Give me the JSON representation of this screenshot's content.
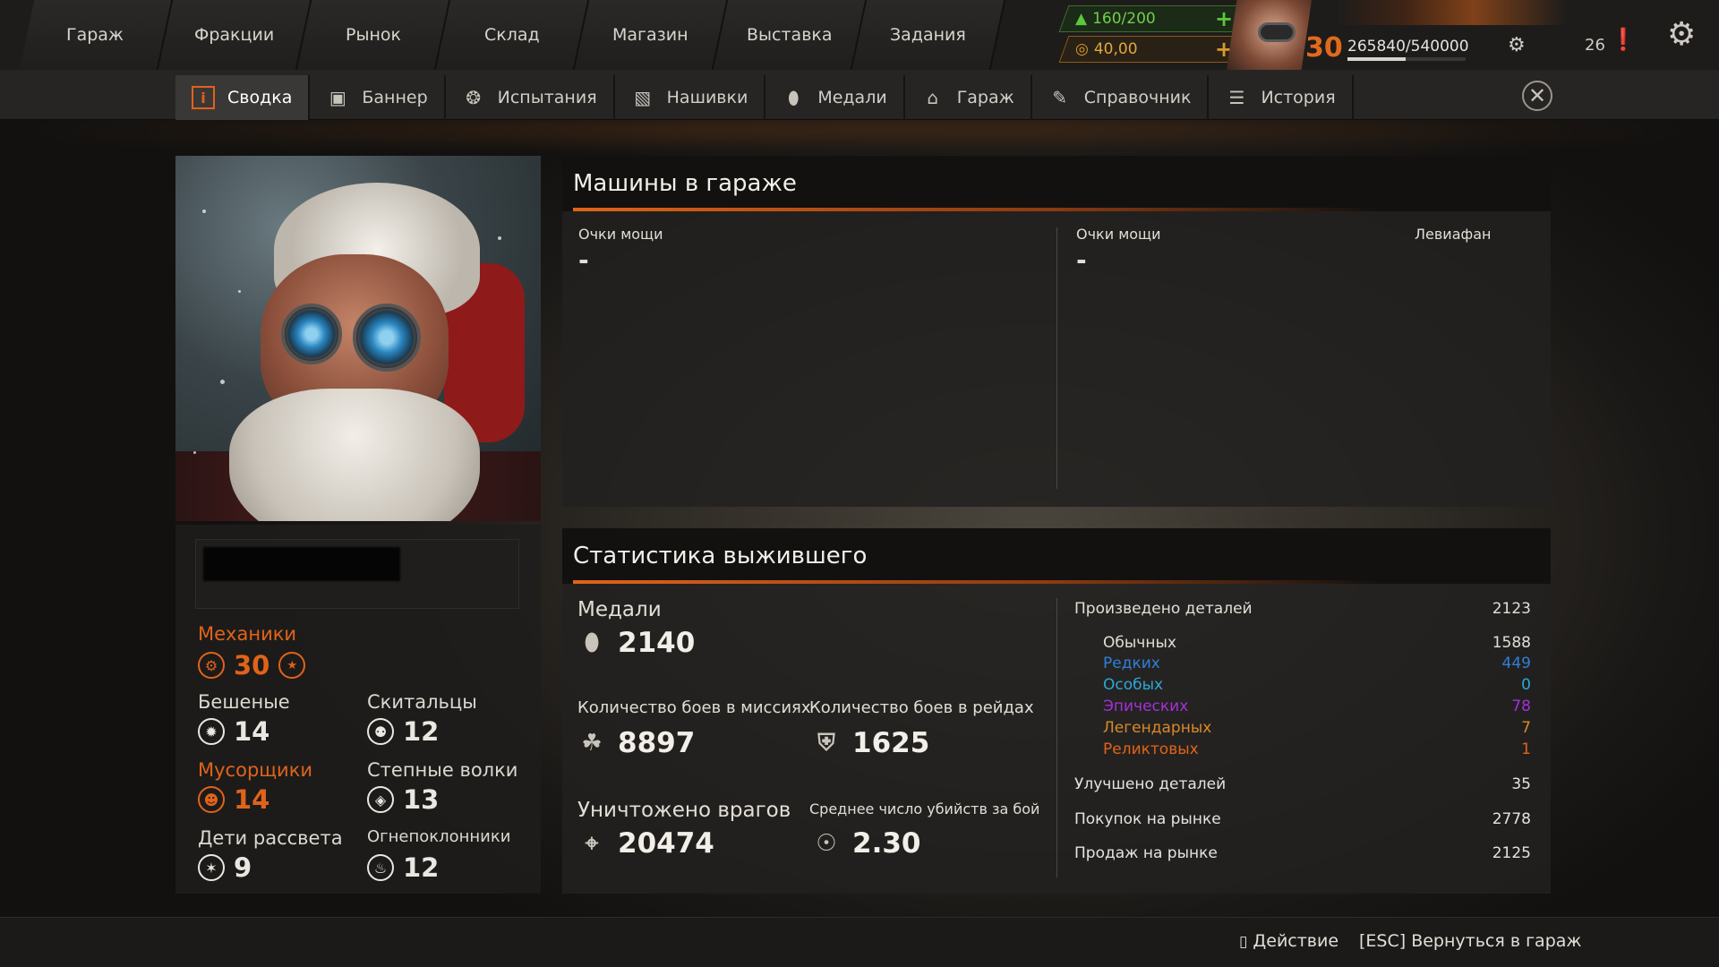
{
  "top_nav": [
    "Гараж",
    "Фракции",
    "Рынок",
    "Склад",
    "Магазин",
    "Выставка",
    "Задания"
  ],
  "resources": {
    "fuel": "160/200",
    "coins": "40,00",
    "plus": "+",
    "level": "30",
    "xp": "265840/540000",
    "xp_fraction": 0.49,
    "notifications": "26"
  },
  "sub_nav": [
    {
      "label": "Сводка",
      "icon": "info-icon"
    },
    {
      "label": "Баннер",
      "icon": "banner-icon"
    },
    {
      "label": "Испытания",
      "icon": "challenge-icon"
    },
    {
      "label": "Нашивки",
      "icon": "patch-icon"
    },
    {
      "label": "Медали",
      "icon": "medal-icon"
    },
    {
      "label": "Гараж",
      "icon": "garage-icon"
    },
    {
      "label": "Справочник",
      "icon": "handbook-icon"
    },
    {
      "label": "История",
      "icon": "history-icon"
    }
  ],
  "factions": [
    {
      "name": "Механики",
      "value": "30",
      "highlight": true
    },
    {
      "name": "Бешеные",
      "value": "14"
    },
    {
      "name": "Скитальцы",
      "value": "12"
    },
    {
      "name": "Мусорщики",
      "value": "14",
      "highlight": true
    },
    {
      "name": "Степные волки",
      "value": "13"
    },
    {
      "name": "Дети рассвета",
      "value": "9"
    },
    {
      "name": "Огнепоклонники",
      "value": "12"
    }
  ],
  "garage": {
    "title": "Машины в гараже",
    "power_label": "Очки мощи",
    "power_value": "-",
    "vehicle_name": "Левиафан"
  },
  "stats": {
    "title": "Статистика выжившего",
    "medals_label": "Медали",
    "medals": "2140",
    "mission_label": "Количество боев в миссиях",
    "missions": "8897",
    "raid_label": "Количество боев в рейдах",
    "raids": "1625",
    "kills_label": "Уничтожено врагов",
    "kills": "20474",
    "avg_label": "Среднее число убийств за бой",
    "avg": "2.30",
    "parts": [
      {
        "label": "Произведено деталей",
        "value": "2123",
        "sub": false,
        "color": "#e2ded6"
      },
      {
        "label": "Обычных",
        "value": "1588",
        "sub": true,
        "color": "#e2ded6"
      },
      {
        "label": "Редких",
        "value": "449",
        "sub": true,
        "color": "#2f7fd8"
      },
      {
        "label": "Особых",
        "value": "0",
        "sub": true,
        "color": "#2aa8d8"
      },
      {
        "label": "Эпических",
        "value": "78",
        "sub": true,
        "color": "#a430d8"
      },
      {
        "label": "Легендарных",
        "value": "7",
        "sub": true,
        "color": "#d88a2a"
      },
      {
        "label": "Реликтовых",
        "value": "1",
        "sub": true,
        "color": "#e0631a"
      }
    ],
    "other": [
      {
        "label": "Улучшено деталей",
        "value": "35"
      },
      {
        "label": "Покупок на рынке",
        "value": "2778"
      },
      {
        "label": "Продаж на рынке",
        "value": "2125"
      }
    ]
  },
  "footer": {
    "action": "Действие",
    "back": "[ESC] Вернуться в гараж"
  }
}
